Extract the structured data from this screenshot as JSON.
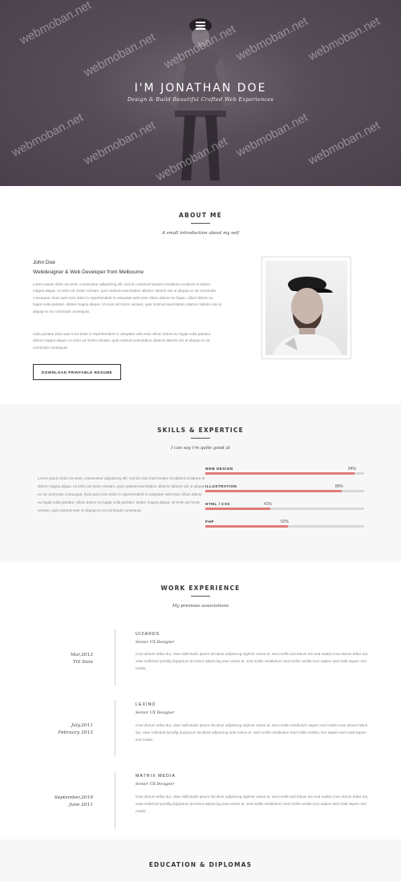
{
  "hero": {
    "title": "I'M JONATHAN DOE",
    "subtitle": "Design & Build Beautiful Crafted Web Experiences",
    "menu_icon": "hamburger-menu-icon",
    "background_color": "#4f4550"
  },
  "watermark": "webmoban.net",
  "about": {
    "title": "ABOUT ME",
    "subtitle": "A small introduction about my self",
    "name": "John Doe",
    "role": "Webdesigner & Web Developer from Melbourne",
    "para1": "Lorem ipsum dolor sit amet, consectetur adipisicing elit, sed do eiusmod tempor incididunt ut labore et dolore magna aliqua. Ut enim ad minim veniam, quis nostrud exercitation ullamco laboris nisi ut aliquip ex ea commodo consequat. Duis aute irure dolor in reprehenderit in voluptate velit esse cillum dolore eu fugiat. cillum dolore eu fugiat nulla pariatur. dolore magna aliqua. Ut enim ad minim veniam, quis nostrud exercitation ullamco laboris nisi ut aliquip ex ea commodo consequat.",
    "para2": "nulla pariatur.Duis aute irure dolor in reprehenderit in voluptate velit esse cillum dolore eu fugiat nulla pariatur. dolore magna aliqua. Ut enim ad minim veniam, quis nostrud exercitation ullamco laboris nisi ut aliquip ex ea commodo consequat.",
    "button": "DOWNLOAD PRINTABLE RESUME"
  },
  "skills": {
    "title": "SKILLS & EXPERTICE",
    "subtitle": "I can say i'm quite good at",
    "para": "Lorem ipsum dolor sit amet, consectetur adipisicing elit, sed do eius mod tempor incididunt ut labore et dolore magna aliqua. Ut enim ad minim veniam, quis nostrud exercitation ullamco laboris nisi ut aliquip ex ea commodo consequat. Duis aute irure dolor in reprehenderit in voluptate velit esse cillum dolore eu fugiat nulla pariatur. cillum dolore eu fugiat nulla pariatur. dolore magna aliqua. Ut enim ad minim veniam, quis nostrud exer ut aliquip ex ea commodo consequat.",
    "items": [
      {
        "label": "WEB DESIGN",
        "pct_text": "94%",
        "value": 94
      },
      {
        "label": "ILLUSTRATION",
        "pct_text": "86%",
        "value": 86
      },
      {
        "label": "HTML / CSS",
        "pct_text": "41%",
        "value": 41
      },
      {
        "label": "PHP",
        "pct_text": "52%",
        "value": 52
      }
    ],
    "bar_color": "#e07b7b"
  },
  "work": {
    "title": "WORK EXPERIENCE",
    "subtitle": "My previous associations",
    "items": [
      {
        "date1": "Mar,2013",
        "date2": "Till Date",
        "company": "UIZARDS",
        "title": "Senior UX Designer",
        "desc": "Cras dictum tellus dui, vitae sollicitudin ipsum tincidunt adipiscing eighme varius at. Sed mollis sed lobum nisi sed mattis.Cras dictum tellus dui, vitae sollicitud tymafig dujcipsum tincidunt adipiscing ante varius at. Sed mollis vestibulum Sed mollis vestibu lum sapien sed matti sapien sed mattis."
      },
      {
        "date1": "July,2011",
        "date2": "February 2013",
        "company": "LEXINO",
        "title": "Senior UX Designer",
        "desc": "Cras dictum tellus dui, vitae sollicitudin ipsum tincidunt adipiscing eighme varius at. Sed mollis vestibulum sapien sed mattis.Cras dictum tellus dui, vitae sollicitud tymafig dujcipsum tincidunt adipiscing ante varius at. Sed mollis vestibulum Sed mollis vestibu lum sapien sed matti sapien sed mattis."
      },
      {
        "date1": "September,2019",
        "date2": "June 2011",
        "company": "MATRIX MEDIA",
        "title": "Senior UX Designer",
        "desc": "Cras dictum tellus dui, vitae sollicitudin ipsum tincidunt adipiscing eighme varius at. Sed mollis sed lobum nisi sed mattis.Cras dictum tellus dui, vitae sollicitud tymafig dujcipsum tincidunt adipiscing ante varius at. Sed mollis vestibulum Sed mollis vestibu lum sapien sed matti sapien sed mattis."
      }
    ]
  },
  "education": {
    "title": "EDUCATION & DIPLOMAS"
  }
}
